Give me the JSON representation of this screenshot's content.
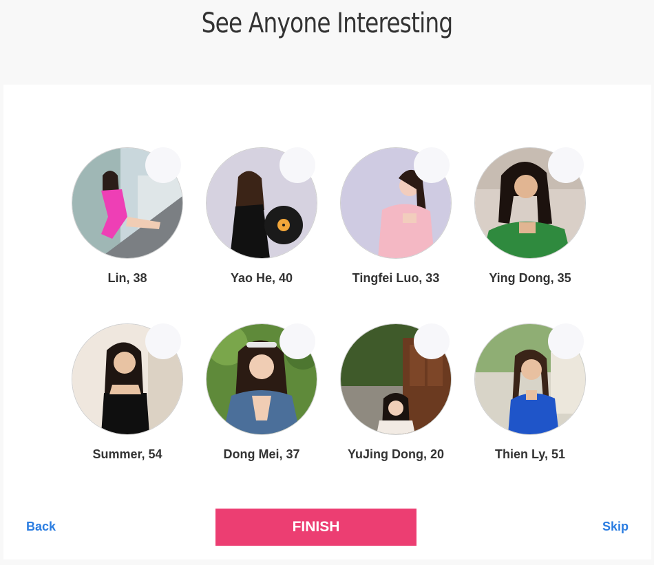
{
  "header": {
    "title": "See Anyone Interesting"
  },
  "profiles": [
    {
      "name": "Lin, 38"
    },
    {
      "name": "Yao He, 40"
    },
    {
      "name": "Tingfei Luo, 33"
    },
    {
      "name": "Ying Dong, 35"
    },
    {
      "name": "Summer, 54"
    },
    {
      "name": "Dong Mei, 37"
    },
    {
      "name": "YuJing Dong, 20"
    },
    {
      "name": "Thien Ly, 51"
    }
  ],
  "footer": {
    "back_label": "Back",
    "finish_label": "FINISH",
    "skip_label": "Skip"
  },
  "colors": {
    "accent": "#ec3e72",
    "link": "#2b7de1",
    "text": "#333333"
  }
}
